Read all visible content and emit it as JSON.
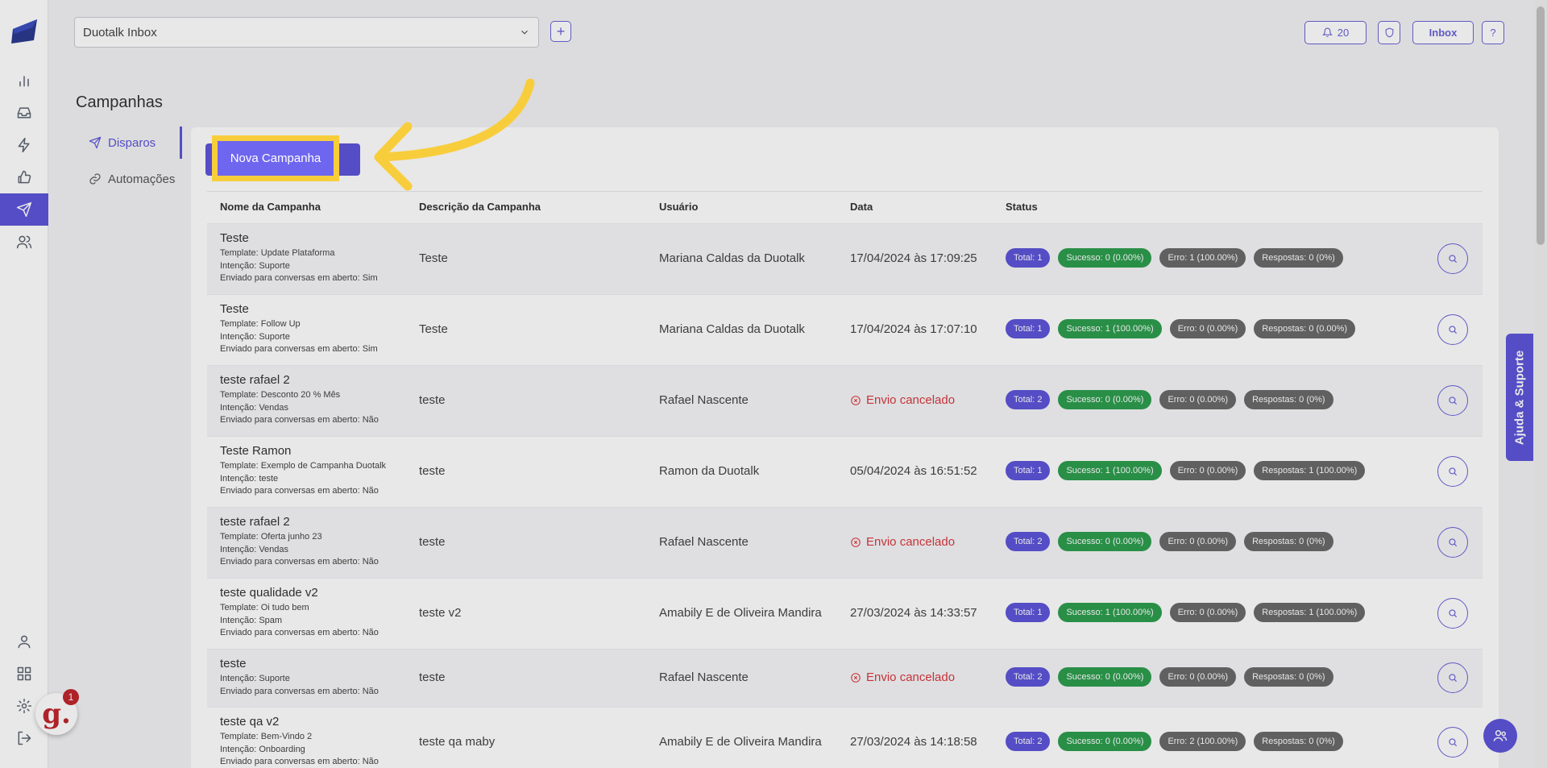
{
  "topbar": {
    "workspace": "Duotalk Inbox",
    "add_label": "+",
    "notifications_count": "20",
    "inbox_label": "Inbox",
    "help_label": "?"
  },
  "page": {
    "title": "Campanhas"
  },
  "subnav": [
    {
      "label": "Disparos",
      "icon": "send-icon",
      "active": true
    },
    {
      "label": "Automações",
      "icon": "link-icon",
      "active": false
    }
  ],
  "new_campaign_label": "Nova Campanha",
  "table": {
    "headers": [
      "Nome da Campanha",
      "Descrição da Campanha",
      "Usuário",
      "Data",
      "Status"
    ],
    "rows": [
      {
        "name": "Teste",
        "meta": [
          "Template: Update Plataforma",
          "Intenção: Suporte",
          "Enviado para conversas em aberto: Sim"
        ],
        "description": "Teste",
        "user": "Mariana Caldas da Duotalk",
        "date": "17/04/2024 às 17:09:25",
        "cancelled": false,
        "status": [
          "Total: 1",
          "Sucesso: 0 (0.00%)",
          "Erro: 1 (100.00%)",
          "Respostas: 0 (0%)"
        ]
      },
      {
        "name": "Teste",
        "meta": [
          "Template: Follow Up",
          "Intenção: Suporte",
          "Enviado para conversas em aberto: Sim"
        ],
        "description": "Teste",
        "user": "Mariana Caldas da Duotalk",
        "date": "17/04/2024 às 17:07:10",
        "cancelled": false,
        "status": [
          "Total: 1",
          "Sucesso: 1 (100.00%)",
          "Erro: 0 (0.00%)",
          "Respostas: 0 (0.00%)"
        ]
      },
      {
        "name": "teste rafael 2",
        "meta": [
          "Template: Desconto 20 % Mês",
          "Intenção: Vendas",
          "Enviado para conversas em aberto: Não"
        ],
        "description": "teste",
        "user": "Rafael Nascente",
        "date": "Envio cancelado",
        "cancelled": true,
        "status": [
          "Total: 2",
          "Sucesso: 0 (0.00%)",
          "Erro: 0 (0.00%)",
          "Respostas: 0 (0%)"
        ]
      },
      {
        "name": "Teste Ramon",
        "meta": [
          "Template: Exemplo de Campanha Duotalk",
          "Intenção: teste",
          "Enviado para conversas em aberto: Não"
        ],
        "description": "teste",
        "user": "Ramon da Duotalk",
        "date": "05/04/2024 às 16:51:52",
        "cancelled": false,
        "status": [
          "Total: 1",
          "Sucesso: 1 (100.00%)",
          "Erro: 0 (0.00%)",
          "Respostas: 1 (100.00%)"
        ]
      },
      {
        "name": "teste rafael 2",
        "meta": [
          "Template: Oferta junho 23",
          "Intenção: Vendas",
          "Enviado para conversas em aberto: Não"
        ],
        "description": "teste",
        "user": "Rafael Nascente",
        "date": "Envio cancelado",
        "cancelled": true,
        "status": [
          "Total: 2",
          "Sucesso: 0 (0.00%)",
          "Erro: 0 (0.00%)",
          "Respostas: 0 (0%)"
        ]
      },
      {
        "name": "teste qualidade v2",
        "meta": [
          "Template: Oi tudo bem",
          "Intenção: Spam",
          "Enviado para conversas em aberto: Não"
        ],
        "description": "teste v2",
        "user": "Amabily E de Oliveira Mandira",
        "date": "27/03/2024 às 14:33:57",
        "cancelled": false,
        "status": [
          "Total: 1",
          "Sucesso: 1 (100.00%)",
          "Erro: 0 (0.00%)",
          "Respostas: 1 (100.00%)"
        ]
      },
      {
        "name": "teste",
        "meta": [
          "Intenção: Suporte",
          "Enviado para conversas em aberto: Não"
        ],
        "description": "teste",
        "user": "Rafael Nascente",
        "date": "Envio cancelado",
        "cancelled": true,
        "status": [
          "Total: 2",
          "Sucesso: 0 (0.00%)",
          "Erro: 0 (0.00%)",
          "Respostas: 0 (0%)"
        ]
      },
      {
        "name": "teste qa v2",
        "meta": [
          "Template: Bem-Vindo 2",
          "Intenção: Onboarding",
          "Enviado para conversas em aberto: Não"
        ],
        "description": "teste qa maby",
        "user": "Amabily E de Oliveira Mandira",
        "date": "27/03/2024 às 14:18:58",
        "cancelled": false,
        "status": [
          "Total: 2",
          "Sucesso: 0 (0.00%)",
          "Erro: 2 (100.00%)",
          "Respostas: 0 (0%)"
        ]
      }
    ]
  },
  "help_tab_label": "Ajuda & Suporte",
  "chat_widget": {
    "glyph": "g.",
    "badge": "1"
  },
  "colors": {
    "accent": "#5d55d9",
    "success": "#2e9e4f",
    "neutral": "#6a6a6a",
    "danger": "#d9393f",
    "highlight": "#f8cd3c"
  }
}
